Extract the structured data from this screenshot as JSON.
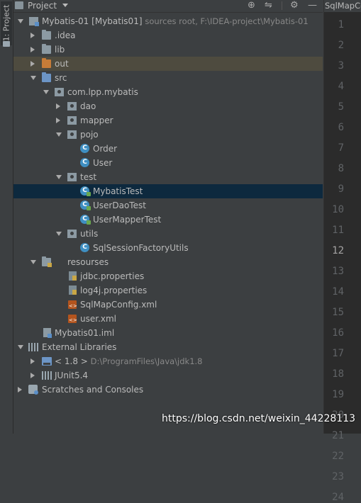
{
  "side_strip": {
    "label": "1: Project"
  },
  "header": {
    "title": "Project",
    "icons": [
      "target-icon",
      "split-icon",
      "gear-icon",
      "minimize-icon"
    ]
  },
  "tree": {
    "root": {
      "name": "Mybatis-01",
      "module": "[Mybatis01]",
      "hint": "sources root,  F:\\IDEA-project\\Mybatis-01"
    },
    "idea": ".idea",
    "lib": "lib",
    "out": "out",
    "src": "src",
    "package": "com.lpp.mybatis",
    "dao": "dao",
    "mapper": "mapper",
    "pojo": "pojo",
    "order": "Order",
    "user": "User",
    "test": "test",
    "mybatis_test": "MybatisTest",
    "user_dao_test": "UserDaoTest",
    "user_mapper_test": "UserMapperTest",
    "utils": "utils",
    "sql_session_factory_utils": "SqlSessionFactoryUtils",
    "resources": "resourses",
    "jdbc_properties": "jdbc.properties",
    "log4j_properties": "log4j.properties",
    "sql_map_config": "SqlMapConfig.xml",
    "user_xml": "user.xml",
    "iml": "Mybatis01.iml",
    "external_libraries": "External Libraries",
    "jdk": {
      "name": "< 1.8 >",
      "path": "D:\\ProgramFiles\\Java\\jdk1.8"
    },
    "junit": "JUnit5.4",
    "scratches": "Scratches and Consoles"
  },
  "editor": {
    "tab": "SqlMapConfig.xml",
    "line_numbers": [
      "1",
      "2",
      "3",
      "4",
      "5",
      "6",
      "7",
      "8",
      "9",
      "10",
      "11",
      "12",
      "13",
      "14",
      "15",
      "16",
      "17",
      "18",
      "19",
      "20",
      "21",
      "22",
      "23",
      "24"
    ],
    "current_line": "12"
  },
  "watermark": "https://blog.csdn.net/weixin_44228113"
}
